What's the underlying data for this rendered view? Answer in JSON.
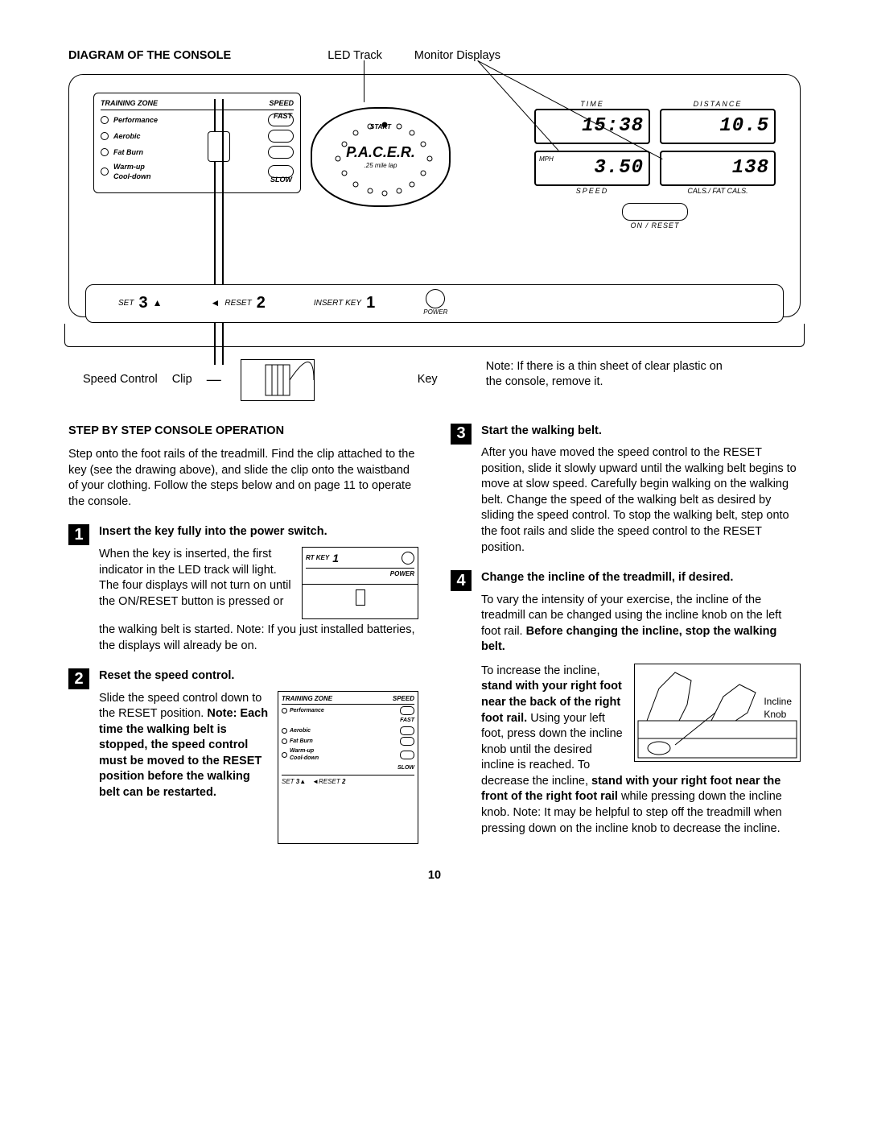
{
  "headings": {
    "diagram": "DIAGRAM OF THE CONSOLE",
    "operation": "STEP BY STEP CONSOLE OPERATION"
  },
  "callouts": {
    "led_track": "LED Track",
    "monitor_displays": "Monitor Displays",
    "speed_control": "Speed Control",
    "clip": "Clip",
    "key": "Key",
    "note": "Note: If there is a thin sheet of clear plastic on the console, remove it."
  },
  "console": {
    "tz_header_left": "TRAINING ZONE",
    "tz_header_right": "SPEED",
    "zones": [
      "Performance",
      "Aerobic",
      "Fat Burn",
      "Warm-up\nCool-down"
    ],
    "fast": "FAST",
    "slow": "SLOW",
    "pacer": "P.A.C.E.R.",
    "pacer_sub": ".25 mile lap",
    "start": "START",
    "displays": {
      "time_lbl": "TIME",
      "time_val": "15:38",
      "dist_lbl": "DISTANCE",
      "dist_val": "10.5",
      "speed_lbl": "SPEED",
      "speed_unit": "MPH",
      "speed_val": "3.50",
      "cals_lbl": "CALS./ FAT CALS.",
      "cals_val": "138"
    },
    "on_reset": "ON / RESET",
    "set": "SET",
    "set_num": "3",
    "reset": "RESET",
    "reset_num": "2",
    "insert_key": "INSERT KEY",
    "insert_num": "1",
    "power": "POWER"
  },
  "intro": "Step onto the foot rails of the treadmill. Find the clip attached to the key (see the drawing above), and slide the clip onto the waistband of your clothing. Follow the steps below and on page 11 to operate the console.",
  "steps": {
    "s1": {
      "num": "1",
      "title": "Insert the key fully into the power switch.",
      "text_a": "When the key is inserted, the first indicator in the LED track will light. The four displays will not turn on until the ON/RESET button is pressed or",
      "text_b": "the walking belt is started. Note: If you just installed batteries, the displays will already be on.",
      "fig_rtkey": "RT KEY",
      "fig_num": "1",
      "fig_power": "POWER"
    },
    "s2": {
      "num": "2",
      "title": "Reset the speed control.",
      "text_a": "Slide the speed control down to the RESET position. ",
      "text_b": "Note: Each time the walking belt is stopped, the speed control must be moved to the RESET position before the walking belt can be restarted.",
      "fig": {
        "tz": "TRAINING ZONE",
        "sp": "SPEED",
        "zones": [
          "Performance",
          "Aerobic",
          "Fat Burn",
          "Warm-up\nCool-down"
        ],
        "fast": "FAST",
        "slow": "SLOW",
        "set": "SET",
        "set_n": "3",
        "reset": "RESET",
        "reset_n": "2"
      }
    },
    "s3": {
      "num": "3",
      "title": "Start the walking belt.",
      "text": "After you have moved the speed control to the RESET position, slide it slowly upward until the walking belt begins to move at slow speed. Carefully begin walking on the walking belt. Change the speed of the walking belt as desired by sliding the speed control. To stop the walking belt, step onto the foot rails and slide the speed control to the RESET position."
    },
    "s4": {
      "num": "4",
      "title": "Change the incline of the treadmill, if desired.",
      "text_a": "To vary the intensity of your exercise, the incline of the treadmill can be changed using the incline knob on the left foot rail. ",
      "text_a_bold": "Before changing the incline, stop the walking belt.",
      "text_b_pre": "To increase the incline, ",
      "text_b_bold": "stand with your right foot near the back of the right foot rail.",
      "text_c_pre": " Using your left foot, press down the incline knob until the desired incline is reached. To decrease the incline, ",
      "text_c_bold": "stand with your right foot near the front of the right foot rail",
      "text_c_post": " while pressing down the incline knob. Note: It may be helpful to step off the treadmill when pressing down on the incline knob to decrease the incline.",
      "fig_label1": "Incline",
      "fig_label2": "Knob"
    }
  },
  "page": "10"
}
